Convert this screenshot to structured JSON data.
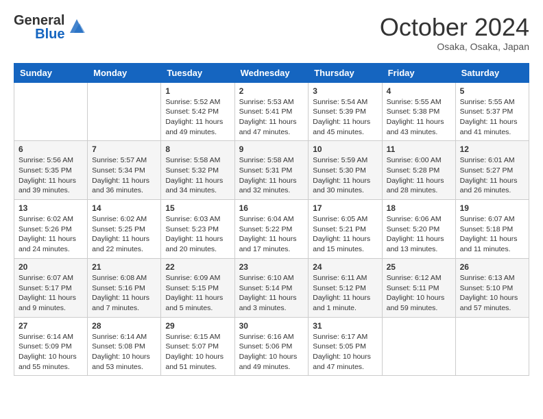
{
  "header": {
    "logo_line1": "General",
    "logo_line2": "Blue",
    "month": "October 2024",
    "location": "Osaka, Osaka, Japan"
  },
  "weekdays": [
    "Sunday",
    "Monday",
    "Tuesday",
    "Wednesday",
    "Thursday",
    "Friday",
    "Saturday"
  ],
  "weeks": [
    [
      {
        "day": "",
        "sunrise": "",
        "sunset": "",
        "daylight": ""
      },
      {
        "day": "",
        "sunrise": "",
        "sunset": "",
        "daylight": ""
      },
      {
        "day": "1",
        "sunrise": "Sunrise: 5:52 AM",
        "sunset": "Sunset: 5:42 PM",
        "daylight": "Daylight: 11 hours and 49 minutes."
      },
      {
        "day": "2",
        "sunrise": "Sunrise: 5:53 AM",
        "sunset": "Sunset: 5:41 PM",
        "daylight": "Daylight: 11 hours and 47 minutes."
      },
      {
        "day": "3",
        "sunrise": "Sunrise: 5:54 AM",
        "sunset": "Sunset: 5:39 PM",
        "daylight": "Daylight: 11 hours and 45 minutes."
      },
      {
        "day": "4",
        "sunrise": "Sunrise: 5:55 AM",
        "sunset": "Sunset: 5:38 PM",
        "daylight": "Daylight: 11 hours and 43 minutes."
      },
      {
        "day": "5",
        "sunrise": "Sunrise: 5:55 AM",
        "sunset": "Sunset: 5:37 PM",
        "daylight": "Daylight: 11 hours and 41 minutes."
      }
    ],
    [
      {
        "day": "6",
        "sunrise": "Sunrise: 5:56 AM",
        "sunset": "Sunset: 5:35 PM",
        "daylight": "Daylight: 11 hours and 39 minutes."
      },
      {
        "day": "7",
        "sunrise": "Sunrise: 5:57 AM",
        "sunset": "Sunset: 5:34 PM",
        "daylight": "Daylight: 11 hours and 36 minutes."
      },
      {
        "day": "8",
        "sunrise": "Sunrise: 5:58 AM",
        "sunset": "Sunset: 5:32 PM",
        "daylight": "Daylight: 11 hours and 34 minutes."
      },
      {
        "day": "9",
        "sunrise": "Sunrise: 5:58 AM",
        "sunset": "Sunset: 5:31 PM",
        "daylight": "Daylight: 11 hours and 32 minutes."
      },
      {
        "day": "10",
        "sunrise": "Sunrise: 5:59 AM",
        "sunset": "Sunset: 5:30 PM",
        "daylight": "Daylight: 11 hours and 30 minutes."
      },
      {
        "day": "11",
        "sunrise": "Sunrise: 6:00 AM",
        "sunset": "Sunset: 5:28 PM",
        "daylight": "Daylight: 11 hours and 28 minutes."
      },
      {
        "day": "12",
        "sunrise": "Sunrise: 6:01 AM",
        "sunset": "Sunset: 5:27 PM",
        "daylight": "Daylight: 11 hours and 26 minutes."
      }
    ],
    [
      {
        "day": "13",
        "sunrise": "Sunrise: 6:02 AM",
        "sunset": "Sunset: 5:26 PM",
        "daylight": "Daylight: 11 hours and 24 minutes."
      },
      {
        "day": "14",
        "sunrise": "Sunrise: 6:02 AM",
        "sunset": "Sunset: 5:25 PM",
        "daylight": "Daylight: 11 hours and 22 minutes."
      },
      {
        "day": "15",
        "sunrise": "Sunrise: 6:03 AM",
        "sunset": "Sunset: 5:23 PM",
        "daylight": "Daylight: 11 hours and 20 minutes."
      },
      {
        "day": "16",
        "sunrise": "Sunrise: 6:04 AM",
        "sunset": "Sunset: 5:22 PM",
        "daylight": "Daylight: 11 hours and 17 minutes."
      },
      {
        "day": "17",
        "sunrise": "Sunrise: 6:05 AM",
        "sunset": "Sunset: 5:21 PM",
        "daylight": "Daylight: 11 hours and 15 minutes."
      },
      {
        "day": "18",
        "sunrise": "Sunrise: 6:06 AM",
        "sunset": "Sunset: 5:20 PM",
        "daylight": "Daylight: 11 hours and 13 minutes."
      },
      {
        "day": "19",
        "sunrise": "Sunrise: 6:07 AM",
        "sunset": "Sunset: 5:18 PM",
        "daylight": "Daylight: 11 hours and 11 minutes."
      }
    ],
    [
      {
        "day": "20",
        "sunrise": "Sunrise: 6:07 AM",
        "sunset": "Sunset: 5:17 PM",
        "daylight": "Daylight: 11 hours and 9 minutes."
      },
      {
        "day": "21",
        "sunrise": "Sunrise: 6:08 AM",
        "sunset": "Sunset: 5:16 PM",
        "daylight": "Daylight: 11 hours and 7 minutes."
      },
      {
        "day": "22",
        "sunrise": "Sunrise: 6:09 AM",
        "sunset": "Sunset: 5:15 PM",
        "daylight": "Daylight: 11 hours and 5 minutes."
      },
      {
        "day": "23",
        "sunrise": "Sunrise: 6:10 AM",
        "sunset": "Sunset: 5:14 PM",
        "daylight": "Daylight: 11 hours and 3 minutes."
      },
      {
        "day": "24",
        "sunrise": "Sunrise: 6:11 AM",
        "sunset": "Sunset: 5:12 PM",
        "daylight": "Daylight: 11 hours and 1 minute."
      },
      {
        "day": "25",
        "sunrise": "Sunrise: 6:12 AM",
        "sunset": "Sunset: 5:11 PM",
        "daylight": "Daylight: 10 hours and 59 minutes."
      },
      {
        "day": "26",
        "sunrise": "Sunrise: 6:13 AM",
        "sunset": "Sunset: 5:10 PM",
        "daylight": "Daylight: 10 hours and 57 minutes."
      }
    ],
    [
      {
        "day": "27",
        "sunrise": "Sunrise: 6:14 AM",
        "sunset": "Sunset: 5:09 PM",
        "daylight": "Daylight: 10 hours and 55 minutes."
      },
      {
        "day": "28",
        "sunrise": "Sunrise: 6:14 AM",
        "sunset": "Sunset: 5:08 PM",
        "daylight": "Daylight: 10 hours and 53 minutes."
      },
      {
        "day": "29",
        "sunrise": "Sunrise: 6:15 AM",
        "sunset": "Sunset: 5:07 PM",
        "daylight": "Daylight: 10 hours and 51 minutes."
      },
      {
        "day": "30",
        "sunrise": "Sunrise: 6:16 AM",
        "sunset": "Sunset: 5:06 PM",
        "daylight": "Daylight: 10 hours and 49 minutes."
      },
      {
        "day": "31",
        "sunrise": "Sunrise: 6:17 AM",
        "sunset": "Sunset: 5:05 PM",
        "daylight": "Daylight: 10 hours and 47 minutes."
      },
      {
        "day": "",
        "sunrise": "",
        "sunset": "",
        "daylight": ""
      },
      {
        "day": "",
        "sunrise": "",
        "sunset": "",
        "daylight": ""
      }
    ]
  ]
}
